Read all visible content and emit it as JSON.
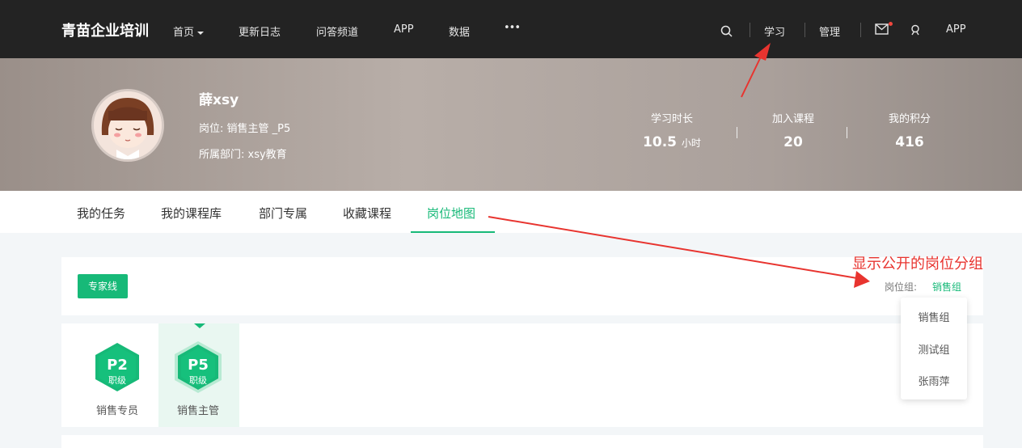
{
  "topbar": {
    "brand": "青苗企业培训",
    "nav": [
      "首页",
      "更新日志",
      "问答频道",
      "APP",
      "数据",
      "•••"
    ],
    "right": {
      "learn": "学习",
      "manage": "管理",
      "app": "APP"
    }
  },
  "profile": {
    "name": "薛xsy",
    "position": "岗位: 销售主管 _P5",
    "department": "所属部门: xsy教育",
    "stats": [
      {
        "label": "学习时长",
        "value": "10.5",
        "unit": "小时"
      },
      {
        "label": "加入课程",
        "value": "20",
        "unit": ""
      },
      {
        "label": "我的积分",
        "value": "416",
        "unit": ""
      }
    ]
  },
  "tabs": [
    "我的任务",
    "我的课程库",
    "部门专属",
    "收藏课程",
    "岗位地图"
  ],
  "active_tab": "岗位地图",
  "filter": {
    "expert_button": "专家线",
    "group_label": "岗位组:",
    "group_value": "销售组",
    "dropdown": [
      "销售组",
      "测试组",
      "张雨萍"
    ]
  },
  "levels": [
    {
      "code": "P2",
      "sub": "职级",
      "name": "销售专员"
    },
    {
      "code": "P5",
      "sub": "职级",
      "name": "销售主管"
    }
  ],
  "annotation": "显示公开的岗位分组",
  "colors": {
    "accent": "#17b978",
    "annotation": "#e8342f",
    "nav_bg": "#232323"
  }
}
